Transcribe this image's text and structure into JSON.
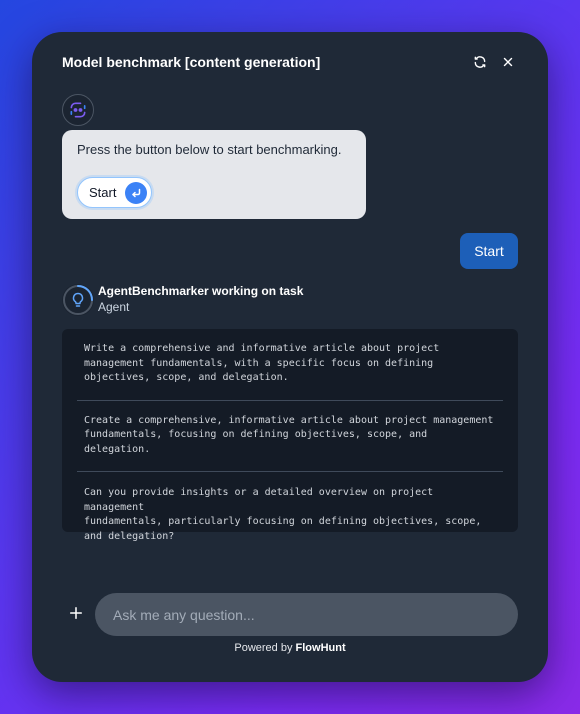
{
  "header": {
    "title": "Model benchmark [content generation]"
  },
  "bot_message": {
    "text": "Press the button below to start benchmarking.",
    "start_button_label": "Start"
  },
  "user_message": {
    "text": "Start"
  },
  "agent": {
    "name": "AgentBenchmarker working on task",
    "role": "Agent",
    "results": [
      "Write a comprehensive and informative article about project\nmanagement fundamentals, with a specific focus on defining\nobjectives, scope, and delegation.",
      "Create a comprehensive, informative article about project management\nfundamentals, focusing on defining objectives, scope, and delegation.",
      "Can you provide insights or a detailed overview on project management\nfundamentals, particularly focusing on defining objectives, scope,\nand delegation?"
    ]
  },
  "input": {
    "placeholder": "Ask me any question..."
  },
  "footer": {
    "powered_by": "Powered by",
    "brand": "FlowHunt"
  },
  "icons": {
    "refresh": "refresh-icon",
    "close": "close-icon",
    "bot": "bot-face-icon",
    "enter": "enter-arrow-icon",
    "agent": "lightbulb-icon",
    "plus": "plus-icon"
  },
  "colors": {
    "panel": "#1f2937",
    "accent": "#1d5fb8",
    "chip_accent": "#3b82f6"
  }
}
